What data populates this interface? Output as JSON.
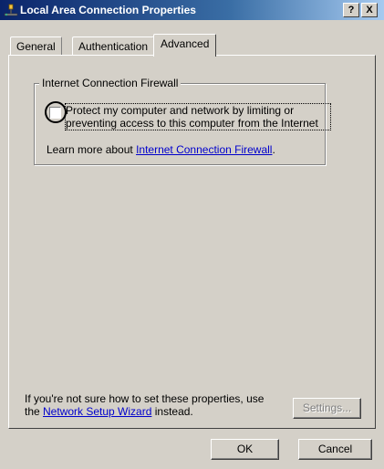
{
  "window": {
    "title": "Local Area Connection Properties",
    "help_button": "?",
    "close_button": "X"
  },
  "tabs": [
    {
      "label": "General"
    },
    {
      "label": "Authentication"
    },
    {
      "label": "Advanced"
    }
  ],
  "firewall": {
    "group_title": "Internet Connection Firewall",
    "checkbox_label": "Protect my computer and network by limiting or preventing access to this computer from the Internet",
    "checkbox_checked": false,
    "learn_prefix": "Learn more about ",
    "learn_link": "Internet Connection Firewall",
    "learn_suffix": "."
  },
  "footer_note": {
    "line1": "If you're not sure how to set these properties, use",
    "line2_prefix": "the ",
    "wizard_link": "Network Setup Wizard",
    "line2_suffix": " instead."
  },
  "buttons": {
    "settings": "Settings...",
    "ok": "OK",
    "cancel": "Cancel"
  },
  "colors": {
    "face": "#d4d0c8",
    "title_dark": "#0a246a",
    "link": "#0000cc"
  }
}
